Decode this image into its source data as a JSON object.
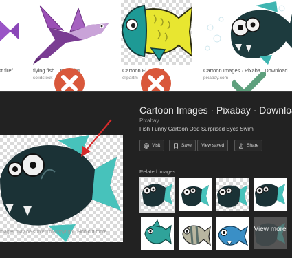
{
  "results": [
    {
      "caption": "ast.firef",
      "source": "",
      "icon": "bowtie-fish-image"
    },
    {
      "caption": "flying fish ...nt backg",
      "source": "solidstock",
      "icon": "purple-flying-fish-image"
    },
    {
      "caption": "Cartoon Fi...op Art",
      "source": "clipartm",
      "icon": "yellow-fish-image"
    },
    {
      "caption": "Cartoon Images · Pixaba...Download",
      "source": "pixabay.com",
      "icon": "piranha-fish-image"
    }
  ],
  "marks": {
    "reject_color": "#d9583b",
    "accept_color": "#5ea07d"
  },
  "panel": {
    "title": "Cartoon Images · Pixabay · Downloa",
    "site": "Pixabay",
    "description": "Fish Funny Cartoon Odd Surprised Eyes Swim",
    "notice": "mages may be subject to copyright",
    "notice_link": "Find out more",
    "buttons": {
      "visit": "Visit",
      "save": "Save",
      "view_saved": "View saved",
      "share": "Share"
    },
    "related_label": "Related images:",
    "view_more": "View more"
  },
  "annotation_color": "#d62b2b"
}
